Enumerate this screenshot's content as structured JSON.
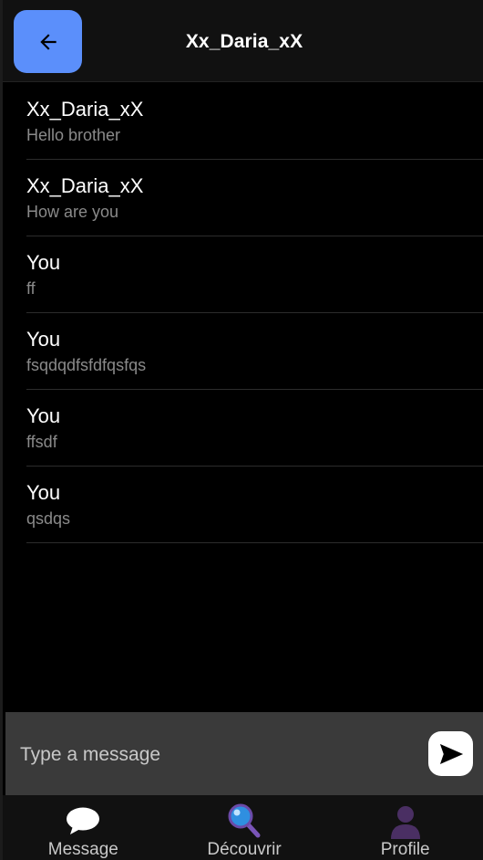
{
  "header": {
    "title": "Xx_Daria_xX",
    "back_icon": "arrow-left-icon",
    "back_button_color": "#5b8ffb"
  },
  "messages": [
    {
      "sender": "Xx_Daria_xX",
      "text": "Hello brother"
    },
    {
      "sender": "Xx_Daria_xX",
      "text": "How are you"
    },
    {
      "sender": "You",
      "text": "ff"
    },
    {
      "sender": "You",
      "text": "fsqdqdfsfdfqsfqs"
    },
    {
      "sender": "You",
      "text": "ffsdf"
    },
    {
      "sender": "You",
      "text": "qsdqs"
    }
  ],
  "composer": {
    "placeholder": "Type a message",
    "value": "",
    "send_icon": "send-icon"
  },
  "bottom_nav": {
    "items": [
      {
        "label": "Message",
        "icon": "speech-bubble-icon"
      },
      {
        "label": "Découvrir",
        "icon": "magnifier-icon"
      },
      {
        "label": "Profile",
        "icon": "person-icon"
      }
    ]
  }
}
